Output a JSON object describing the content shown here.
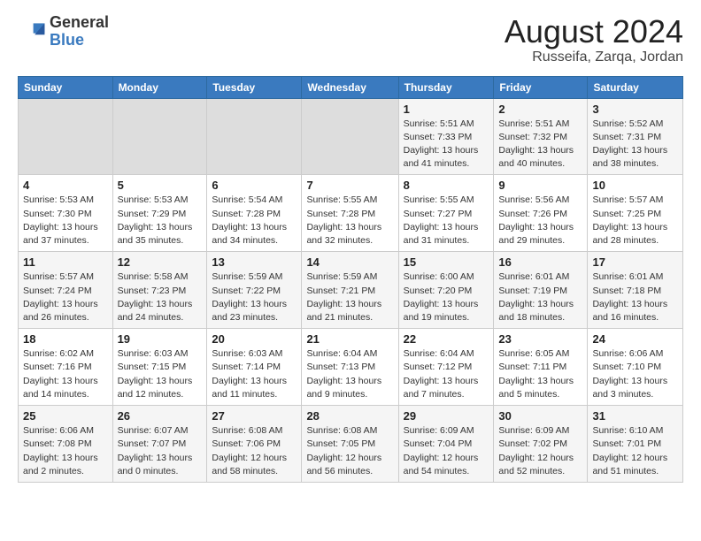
{
  "header": {
    "logo_general": "General",
    "logo_blue": "Blue",
    "title": "August 2024",
    "subtitle": "Russeifa, Zarqa, Jordan"
  },
  "days_of_week": [
    "Sunday",
    "Monday",
    "Tuesday",
    "Wednesday",
    "Thursday",
    "Friday",
    "Saturday"
  ],
  "weeks": [
    [
      {
        "num": "",
        "info": "",
        "empty": true
      },
      {
        "num": "",
        "info": "",
        "empty": true
      },
      {
        "num": "",
        "info": "",
        "empty": true
      },
      {
        "num": "",
        "info": "",
        "empty": true
      },
      {
        "num": "1",
        "info": "Sunrise: 5:51 AM\nSunset: 7:33 PM\nDaylight: 13 hours\nand 41 minutes."
      },
      {
        "num": "2",
        "info": "Sunrise: 5:51 AM\nSunset: 7:32 PM\nDaylight: 13 hours\nand 40 minutes."
      },
      {
        "num": "3",
        "info": "Sunrise: 5:52 AM\nSunset: 7:31 PM\nDaylight: 13 hours\nand 38 minutes."
      }
    ],
    [
      {
        "num": "4",
        "info": "Sunrise: 5:53 AM\nSunset: 7:30 PM\nDaylight: 13 hours\nand 37 minutes."
      },
      {
        "num": "5",
        "info": "Sunrise: 5:53 AM\nSunset: 7:29 PM\nDaylight: 13 hours\nand 35 minutes."
      },
      {
        "num": "6",
        "info": "Sunrise: 5:54 AM\nSunset: 7:28 PM\nDaylight: 13 hours\nand 34 minutes."
      },
      {
        "num": "7",
        "info": "Sunrise: 5:55 AM\nSunset: 7:28 PM\nDaylight: 13 hours\nand 32 minutes."
      },
      {
        "num": "8",
        "info": "Sunrise: 5:55 AM\nSunset: 7:27 PM\nDaylight: 13 hours\nand 31 minutes."
      },
      {
        "num": "9",
        "info": "Sunrise: 5:56 AM\nSunset: 7:26 PM\nDaylight: 13 hours\nand 29 minutes."
      },
      {
        "num": "10",
        "info": "Sunrise: 5:57 AM\nSunset: 7:25 PM\nDaylight: 13 hours\nand 28 minutes."
      }
    ],
    [
      {
        "num": "11",
        "info": "Sunrise: 5:57 AM\nSunset: 7:24 PM\nDaylight: 13 hours\nand 26 minutes."
      },
      {
        "num": "12",
        "info": "Sunrise: 5:58 AM\nSunset: 7:23 PM\nDaylight: 13 hours\nand 24 minutes."
      },
      {
        "num": "13",
        "info": "Sunrise: 5:59 AM\nSunset: 7:22 PM\nDaylight: 13 hours\nand 23 minutes."
      },
      {
        "num": "14",
        "info": "Sunrise: 5:59 AM\nSunset: 7:21 PM\nDaylight: 13 hours\nand 21 minutes."
      },
      {
        "num": "15",
        "info": "Sunrise: 6:00 AM\nSunset: 7:20 PM\nDaylight: 13 hours\nand 19 minutes."
      },
      {
        "num": "16",
        "info": "Sunrise: 6:01 AM\nSunset: 7:19 PM\nDaylight: 13 hours\nand 18 minutes."
      },
      {
        "num": "17",
        "info": "Sunrise: 6:01 AM\nSunset: 7:18 PM\nDaylight: 13 hours\nand 16 minutes."
      }
    ],
    [
      {
        "num": "18",
        "info": "Sunrise: 6:02 AM\nSunset: 7:16 PM\nDaylight: 13 hours\nand 14 minutes."
      },
      {
        "num": "19",
        "info": "Sunrise: 6:03 AM\nSunset: 7:15 PM\nDaylight: 13 hours\nand 12 minutes."
      },
      {
        "num": "20",
        "info": "Sunrise: 6:03 AM\nSunset: 7:14 PM\nDaylight: 13 hours\nand 11 minutes."
      },
      {
        "num": "21",
        "info": "Sunrise: 6:04 AM\nSunset: 7:13 PM\nDaylight: 13 hours\nand 9 minutes."
      },
      {
        "num": "22",
        "info": "Sunrise: 6:04 AM\nSunset: 7:12 PM\nDaylight: 13 hours\nand 7 minutes."
      },
      {
        "num": "23",
        "info": "Sunrise: 6:05 AM\nSunset: 7:11 PM\nDaylight: 13 hours\nand 5 minutes."
      },
      {
        "num": "24",
        "info": "Sunrise: 6:06 AM\nSunset: 7:10 PM\nDaylight: 13 hours\nand 3 minutes."
      }
    ],
    [
      {
        "num": "25",
        "info": "Sunrise: 6:06 AM\nSunset: 7:08 PM\nDaylight: 13 hours\nand 2 minutes."
      },
      {
        "num": "26",
        "info": "Sunrise: 6:07 AM\nSunset: 7:07 PM\nDaylight: 13 hours\nand 0 minutes."
      },
      {
        "num": "27",
        "info": "Sunrise: 6:08 AM\nSunset: 7:06 PM\nDaylight: 12 hours\nand 58 minutes."
      },
      {
        "num": "28",
        "info": "Sunrise: 6:08 AM\nSunset: 7:05 PM\nDaylight: 12 hours\nand 56 minutes."
      },
      {
        "num": "29",
        "info": "Sunrise: 6:09 AM\nSunset: 7:04 PM\nDaylight: 12 hours\nand 54 minutes."
      },
      {
        "num": "30",
        "info": "Sunrise: 6:09 AM\nSunset: 7:02 PM\nDaylight: 12 hours\nand 52 minutes."
      },
      {
        "num": "31",
        "info": "Sunrise: 6:10 AM\nSunset: 7:01 PM\nDaylight: 12 hours\nand 51 minutes."
      }
    ]
  ]
}
